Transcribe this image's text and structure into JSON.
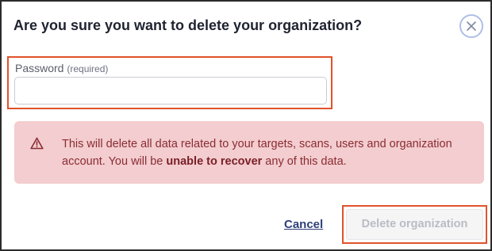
{
  "dialog": {
    "title": "Are you sure you want to delete your organization?",
    "close_icon": "close-icon"
  },
  "password": {
    "label": "Password",
    "required_hint": "(required)",
    "value": "",
    "placeholder": ""
  },
  "alert": {
    "icon": "warning-icon",
    "text_before": "This will delete all data related to your targets, scans, users and organization account. You will be ",
    "text_emphasis": "unable to recover",
    "text_after": " any of this data."
  },
  "actions": {
    "cancel_label": "Cancel",
    "delete_label": "Delete organization",
    "delete_disabled": true
  },
  "colors": {
    "highlight": "#e0522b",
    "alert_bg": "#f3cdcf",
    "alert_text": "#8a2c33",
    "link": "#2e3f7a",
    "disabled_text": "#b9bcc4"
  }
}
